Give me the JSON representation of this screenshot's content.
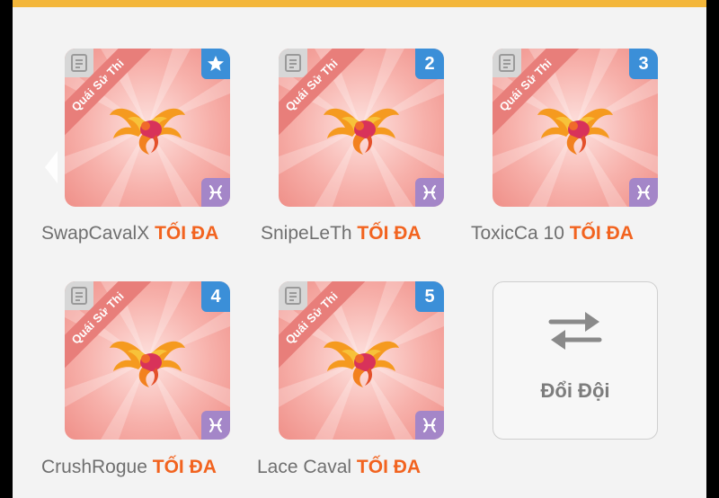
{
  "team": {
    "cards": [
      {
        "type_label": "Quái Sử Thi",
        "rank": "★",
        "rank_icon": "star-icon",
        "name": "SwapCavalX",
        "status": "TỐI ĐA",
        "element_icon": "pisces-icon",
        "creature_icon": "phoenix-dragon-icon"
      },
      {
        "type_label": "Quái Sử Thi",
        "rank": "2",
        "name": "SnipeLeTh",
        "status": "TỐI ĐA",
        "element_icon": "pisces-icon",
        "creature_icon": "phoenix-dragon-icon"
      },
      {
        "type_label": "Quái Sử Thi",
        "rank": "3",
        "name": "ToxicCa 10",
        "status": "TỐI ĐA",
        "element_icon": "pisces-icon",
        "creature_icon": "phoenix-dragon-icon"
      },
      {
        "type_label": "Quái Sử Thi",
        "rank": "4",
        "name": "CrushRogue",
        "status": "TỐI ĐA",
        "element_icon": "pisces-icon",
        "creature_icon": "phoenix-dragon-icon"
      },
      {
        "type_label": "Quái Sử Thi",
        "rank": "5",
        "name": "Lace Caval",
        "status": "TỐI ĐA",
        "element_icon": "pisces-icon",
        "creature_icon": "phoenix-dragon-icon"
      }
    ],
    "swap_button": {
      "label": "Đổi Đội",
      "icon": "swap-arrows-icon"
    }
  },
  "colors": {
    "accent_bar": "#f3b63a",
    "rank_badge": "#3b8fd8",
    "element_badge": "#a486c8",
    "ribbon": "#e87e7a",
    "max_text": "#f2631f",
    "name_text": "#6f6f6f"
  }
}
